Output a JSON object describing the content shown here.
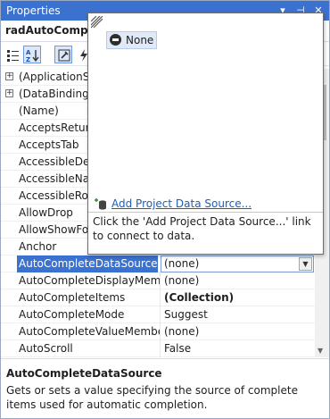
{
  "window": {
    "title": "Properties",
    "buttons": [
      "▾",
      "⊣",
      "✕"
    ]
  },
  "object_bar": {
    "name": "radAutoComplet",
    "dropdown": "▾"
  },
  "grid": {
    "rows": [
      {
        "name": "(ApplicationSe",
        "value": "",
        "expandable": true
      },
      {
        "name": "(DataBindings)",
        "value": "",
        "expandable": true
      },
      {
        "name": "(Name)",
        "value": ""
      },
      {
        "name": "AcceptsReturn",
        "value": ""
      },
      {
        "name": "AcceptsTab",
        "value": ""
      },
      {
        "name": "AccessibleDesc",
        "value": ""
      },
      {
        "name": "AccessibleNam",
        "value": ""
      },
      {
        "name": "AccessibleRole",
        "value": ""
      },
      {
        "name": "AllowDrop",
        "value": ""
      },
      {
        "name": "AllowShowFoc",
        "value": ""
      },
      {
        "name": "Anchor",
        "value": ""
      },
      {
        "name": "AutoCompleteDataSource",
        "value": "(none)",
        "selected": true
      },
      {
        "name": "AutoCompleteDisplayMembe",
        "value": "(none)"
      },
      {
        "name": "AutoCompleteItems",
        "value": "(Collection)",
        "bold": true
      },
      {
        "name": "AutoCompleteMode",
        "value": "Suggest"
      },
      {
        "name": "AutoCompleteValueMember",
        "value": "(none)"
      },
      {
        "name": "AutoScroll",
        "value": "False"
      }
    ]
  },
  "description": {
    "title": "AutoCompleteDataSource",
    "text": "Gets or sets a value specifying the source of complete items used for automatic completion."
  },
  "popup": {
    "none_label": "None",
    "add_link": "Add Project Data Source...",
    "help": "Click the 'Add Project Data Source...' link to connect to data."
  }
}
